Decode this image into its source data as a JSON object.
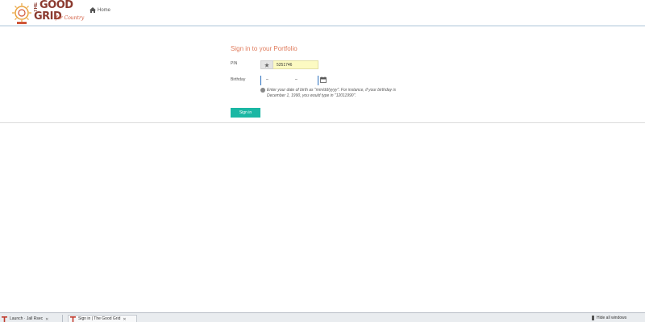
{
  "header": {
    "logo": {
      "the": "THE",
      "good": "GOOD",
      "grid": "GRID",
      "tagline": "for Country"
    },
    "home_label": "Home"
  },
  "signin": {
    "title": "Sign in to your Portfolio",
    "pin_label": "PIN",
    "pin_value": "5251746",
    "birthday_label": "Birthday",
    "birthday_part1": "–",
    "birthday_part2": "–",
    "help_text": "Enter your date of birth as \"mm/dd/yyyy\". For instance, if your birthday is December 1, 1990, you would type in \"12011990\".",
    "button_label": "Sign in"
  },
  "taskbar": {
    "tasks": [
      {
        "label": "Launch · Jall Rsec"
      },
      {
        "label": "Sign in | The Good Grid"
      }
    ],
    "tray_text": "Hide all windows"
  },
  "colors": {
    "accent_title": "#e07b5c",
    "button": "#1bb7a4",
    "logo_brown": "#8b3a2f",
    "pin_bg": "#fcfac2"
  }
}
